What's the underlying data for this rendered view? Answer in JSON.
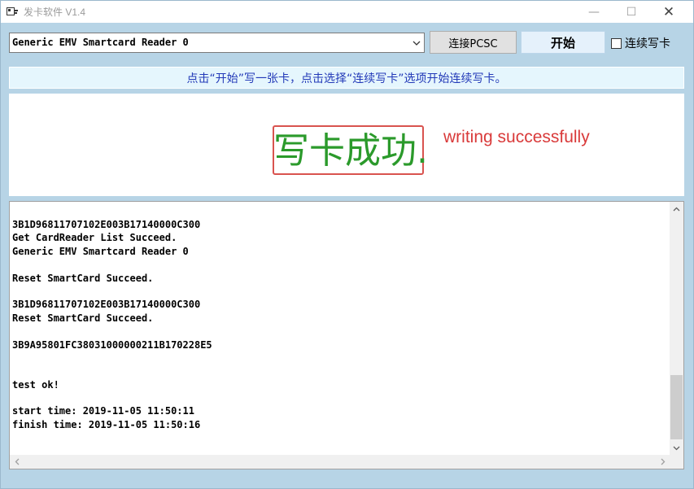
{
  "window": {
    "title": "发卡软件 V1.4",
    "controls": {
      "minimize": "—",
      "maximize": "☐",
      "close": "✕"
    }
  },
  "toolbar": {
    "reader_value": "Generic EMV Smartcard Reader 0",
    "connect_label": "连接PCSC",
    "start_label": "开始",
    "continuous_label": "连续写卡",
    "continuous_checked": false
  },
  "hint": {
    "text": "点击“开始”写一张卡，点击选择“连续写卡”选项开始连续写卡。"
  },
  "status": {
    "message": "写卡成功.",
    "annotation": "writing successfully",
    "message_color": "#2b9a2b",
    "annotation_color": "#d93a3a"
  },
  "log": {
    "lines": [
      "3B1D96811707102E003B17140000C300",
      "Get CardReader List Succeed.",
      "Generic EMV Smartcard Reader 0",
      "",
      "Reset SmartCard Succeed.",
      "",
      "3B1D96811707102E003B17140000C300",
      "Reset SmartCard Succeed.",
      "",
      "3B9A95801FC38031000000211B170228E5",
      "",
      "",
      "test ok!",
      "",
      "start time: 2019-11-05 11:50:11",
      "finish time: 2019-11-05 11:50:16"
    ]
  },
  "icons": {
    "app": "card-app-icon",
    "dropdown": "chevron-down-icon",
    "scroll_up": "arrow-up-icon",
    "scroll_down": "arrow-down-icon",
    "scroll_left": "arrow-left-icon",
    "scroll_right": "arrow-right-icon"
  }
}
